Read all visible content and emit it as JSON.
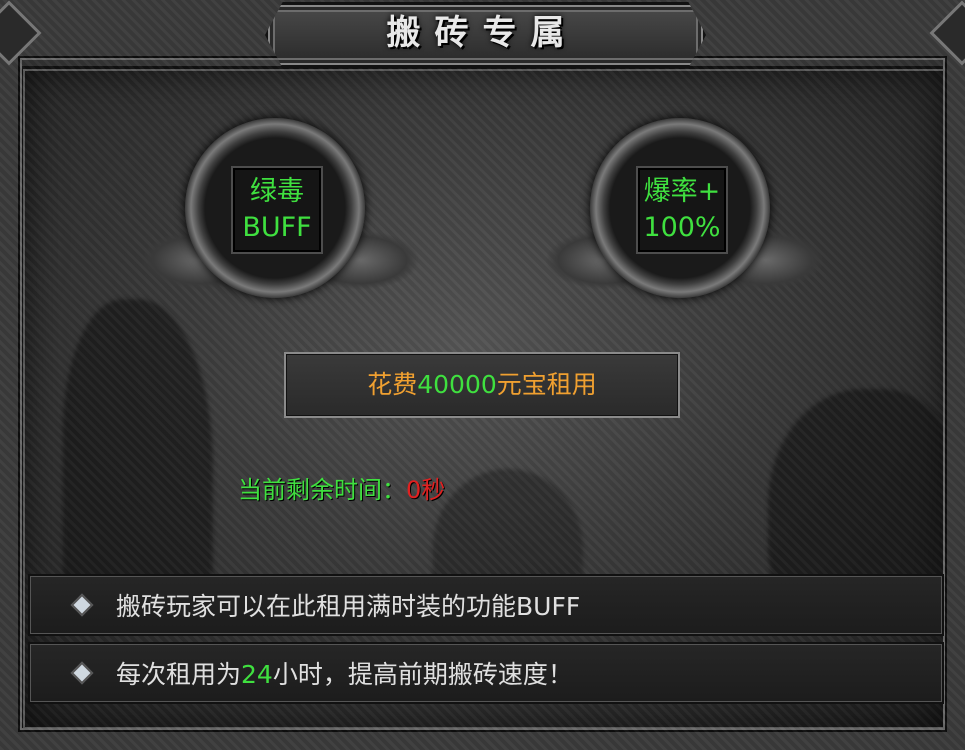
{
  "title": "搬砖专属",
  "buffs": [
    {
      "line1": "绿毒",
      "line2": "BUFF"
    },
    {
      "line1": "爆率+",
      "line2": "100%"
    }
  ],
  "rent": {
    "prefix": "花费",
    "amount": "40000",
    "suffix": "元宝租用"
  },
  "remaining": {
    "label": "当前剩余时间：",
    "value": "0秒"
  },
  "info": {
    "line1": "搬砖玩家可以在此租用满时装的功能BUFF",
    "line2_prefix": "每次租用为",
    "line2_hours": "24",
    "line2_suffix": "小时，提高前期搬砖速度！"
  },
  "colors": {
    "buff_text": "#3fe03f",
    "price_text": "#f0a030",
    "timer_value": "#e02020"
  }
}
